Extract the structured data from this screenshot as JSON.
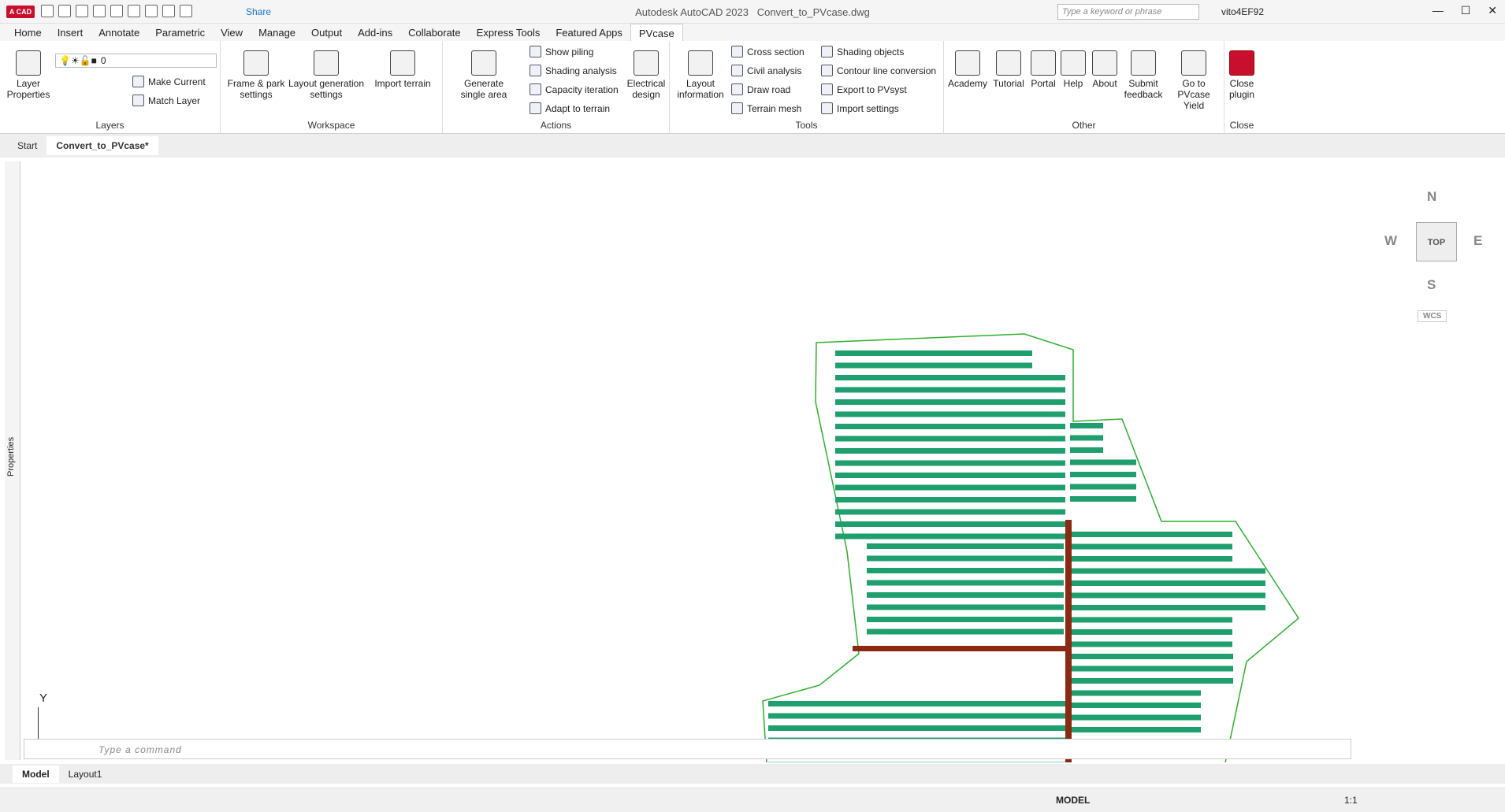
{
  "titlebar": {
    "logo": "A CAD",
    "app": "Autodesk AutoCAD 2023",
    "file": "Convert_to_PVcase.dwg",
    "share": "Share",
    "search_placeholder": "Type a keyword or phrase",
    "user": "vito4EF92"
  },
  "tabs": [
    "Home",
    "Insert",
    "Annotate",
    "Parametric",
    "View",
    "Manage",
    "Output",
    "Add-ins",
    "Collaborate",
    "Express Tools",
    "Featured Apps",
    "PVcase"
  ],
  "ribbon": {
    "layers": {
      "label": "Layers",
      "layer_props": "Layer Properties",
      "current": "0",
      "make_current": "Make Current",
      "match_layer": "Match Layer"
    },
    "workspace": {
      "label": "Workspace",
      "frame": "Frame & park settings",
      "layout_gen": "Layout generation settings",
      "import_terrain": "Import terrain"
    },
    "actions": {
      "label": "Actions",
      "generate": "Generate single area",
      "show_piling": "Show piling",
      "shading": "Shading analysis",
      "capacity": "Capacity iteration",
      "adapt": "Adapt to terrain",
      "electrical": "Electrical design"
    },
    "tools": {
      "label": "Tools",
      "layout_info": "Layout information",
      "cross": "Cross section",
      "civil": "Civil analysis",
      "road": "Draw road",
      "mesh": "Terrain mesh",
      "shading_obj": "Shading objects",
      "contour": "Contour line conversion",
      "export": "Export to PVsyst",
      "import_set": "Import settings"
    },
    "other": {
      "label": "Other",
      "academy": "Academy",
      "tutorial": "Tutorial",
      "portal": "Portal",
      "help": "Help",
      "about": "About",
      "feedback": "Submit feedback",
      "yield": "Go to PVcase Yield"
    },
    "close": {
      "label": "Close",
      "btn": "Close plugin"
    }
  },
  "doctabs": [
    "Start",
    "Convert_to_PVcase*"
  ],
  "properties": "Properties",
  "viewcube": {
    "n": "N",
    "s": "S",
    "e": "E",
    "w": "W",
    "top": "TOP",
    "wcs": "WCS"
  },
  "ucs": "Y",
  "command": {
    "placeholder": "Type a command"
  },
  "layouts": [
    "Model",
    "Layout1"
  ],
  "status": {
    "model": "MODEL",
    "scale": "1:1"
  }
}
